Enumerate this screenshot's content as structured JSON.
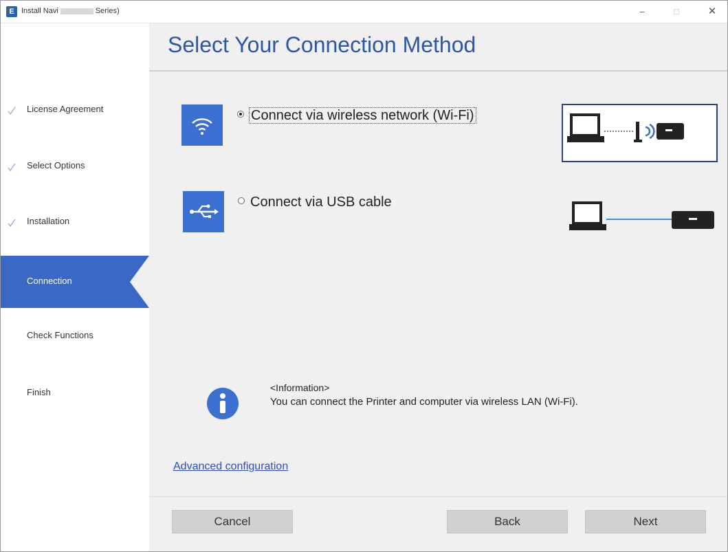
{
  "window": {
    "app_icon": "E",
    "title_start": "Install Navi",
    "title_end": "Series)",
    "minimize": "–",
    "maximize": "□",
    "close": "✕"
  },
  "sidebar": {
    "steps": [
      {
        "label": "License Agreement",
        "status": "done"
      },
      {
        "label": "Select Options",
        "status": "done"
      },
      {
        "label": "Installation",
        "status": "done"
      },
      {
        "label": "Connection",
        "status": "active"
      },
      {
        "label": "Check Functions",
        "status": "pending"
      },
      {
        "label": "Finish",
        "status": "pending"
      }
    ]
  },
  "main": {
    "title": "Select Your Connection Method",
    "options": [
      {
        "label": "Connect via wireless network (Wi-Fi)",
        "selected": true,
        "icon": "wifi-icon"
      },
      {
        "label": "Connect via USB cable",
        "selected": false,
        "icon": "usb-icon"
      }
    ],
    "info": {
      "heading": "<Information>",
      "text": "You can connect the Printer and computer via wireless LAN (Wi-Fi)."
    },
    "advanced_link": "Advanced configuration"
  },
  "footer": {
    "cancel": "Cancel",
    "back": "Back",
    "next": "Next"
  },
  "colors": {
    "accent": "#3a68c6",
    "title": "#2d56a8",
    "icon_bg": "#3b6fd0",
    "link": "#2b4cc4",
    "button": "#d1d1d1"
  }
}
